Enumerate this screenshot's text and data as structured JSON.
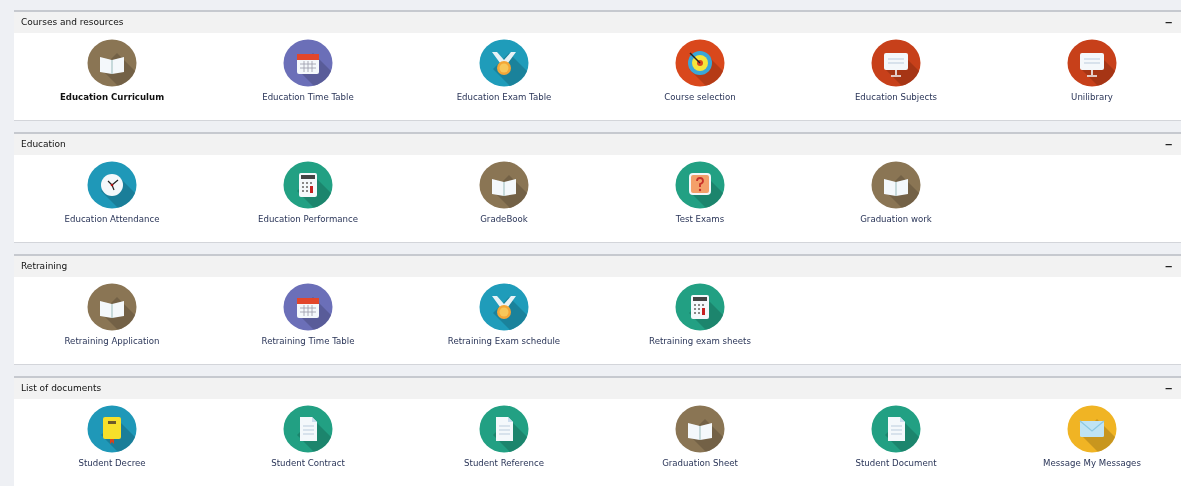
{
  "sections": [
    {
      "title": "Courses and resources",
      "collapse": "−",
      "items": [
        {
          "label": "Education Curriculum",
          "kind": "book",
          "selected": true
        },
        {
          "label": "Education Time Table",
          "kind": "calendar",
          "selected": false
        },
        {
          "label": "Education Exam Table",
          "kind": "medal",
          "selected": false
        },
        {
          "label": "Course selection",
          "kind": "target",
          "selected": false
        },
        {
          "label": "Education Subjects",
          "kind": "board",
          "selected": false
        },
        {
          "label": "Unilibrary",
          "kind": "board",
          "selected": false
        }
      ]
    },
    {
      "title": "Education",
      "collapse": "−",
      "items": [
        {
          "label": "Education Attendance",
          "kind": "clock",
          "selected": false
        },
        {
          "label": "Education Performance",
          "kind": "calculator",
          "selected": false
        },
        {
          "label": "GradeBook",
          "kind": "book",
          "selected": false
        },
        {
          "label": "Test Exams",
          "kind": "question",
          "selected": false
        },
        {
          "label": "Graduation work",
          "kind": "book",
          "selected": false
        }
      ]
    },
    {
      "title": "Retraining",
      "collapse": "−",
      "items": [
        {
          "label": "Retraining Application",
          "kind": "book",
          "selected": false
        },
        {
          "label": "Retraining Time Table",
          "kind": "calendar",
          "selected": false
        },
        {
          "label": "Retraining Exam schedule",
          "kind": "medal",
          "selected": false
        },
        {
          "label": "Retraining exam sheets",
          "kind": "calculator",
          "selected": false
        }
      ]
    },
    {
      "title": "List of documents",
      "collapse": "−",
      "items": [
        {
          "label": "Student Decree",
          "kind": "notebook",
          "selected": false
        },
        {
          "label": "Student Contract",
          "kind": "document",
          "selected": false
        },
        {
          "label": "Student Reference",
          "kind": "document",
          "selected": false
        },
        {
          "label": "Graduation Sheet",
          "kind": "book",
          "selected": false
        },
        {
          "label": "Student Document",
          "kind": "document",
          "selected": false
        },
        {
          "label": "Message My Messages",
          "kind": "envelope",
          "selected": false
        }
      ]
    }
  ]
}
